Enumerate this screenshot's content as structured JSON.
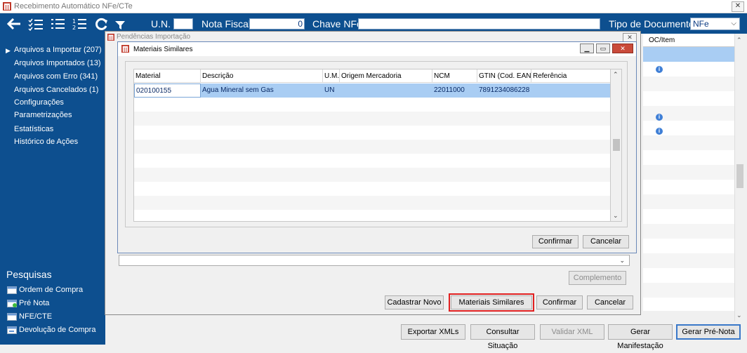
{
  "window": {
    "title": "Recebimento Automático NFe/CTe",
    "close_glyph": "✕"
  },
  "toolbar": {
    "un_label": "U.N.",
    "un_value": "",
    "nota_label": "Nota Fiscal",
    "nota_value": "0",
    "chave_label": "Chave NFe",
    "chave_value": "",
    "tipo_label": "Tipo de Documento",
    "tipo_value": "NFe",
    "icons": [
      "arrow-left-icon",
      "checklist-icon",
      "list-icon",
      "numbered-list-icon",
      "refresh-icon",
      "filter-icon"
    ]
  },
  "sidebar": {
    "items": [
      {
        "label": "Arquivos a Importar (207)",
        "active": true
      },
      {
        "label": "Arquivos Importados (13)"
      },
      {
        "label": "Arquivos com Erro (341)"
      },
      {
        "label": "Arquivos Cancelados (1)"
      },
      {
        "label": "Configurações"
      },
      {
        "label": "Parametrizações"
      },
      {
        "label": "Estatísticas"
      },
      {
        "label": "Histórico de Ações"
      }
    ],
    "search_title": "Pesquisas",
    "searches": [
      {
        "label": "Ordem de Compra"
      },
      {
        "label": "Pré Nota"
      },
      {
        "label": "NFE/CTE"
      },
      {
        "label": "Devolução de Compra"
      }
    ]
  },
  "background_grid": {
    "header": "OC/Item",
    "info_glyph": "i"
  },
  "bottom_buttons": {
    "exportar": "Exportar XMLs",
    "consultar": "Consultar Situação",
    "validar": "Validar XML",
    "gerar_manifestacao": "Gerar Manifestação",
    "gerar_pre_nota": "Gerar Pré-Nota"
  },
  "pendencias_dialog": {
    "title": "Pendências Importação",
    "close_glyph": "✕",
    "complemento": "Complemento",
    "cadastrar_novo": "Cadastrar Novo",
    "materiais_similares": "Materiais Similares",
    "confirmar": "Confirmar",
    "cancelar": "Cancelar"
  },
  "materiais_dialog": {
    "title": "Materiais Similares",
    "confirmar": "Confirmar",
    "cancelar": "Cancelar",
    "columns": [
      "Material",
      "Descrição",
      "U.M.",
      "Origem Mercadoria",
      "NCM",
      "GTIN (Cod. EAN)",
      "Referência"
    ],
    "rows": [
      {
        "material": "020100155",
        "descricao": "Agua Mineral sem Gas",
        "um": "UN",
        "origem": "",
        "ncm": "22011000",
        "gtin": "7891234086228",
        "referencia": ""
      }
    ]
  },
  "colors": {
    "brand_blue": "#0d4f8f",
    "selection_blue": "#a9cdf3",
    "highlight_red": "#e02020"
  }
}
